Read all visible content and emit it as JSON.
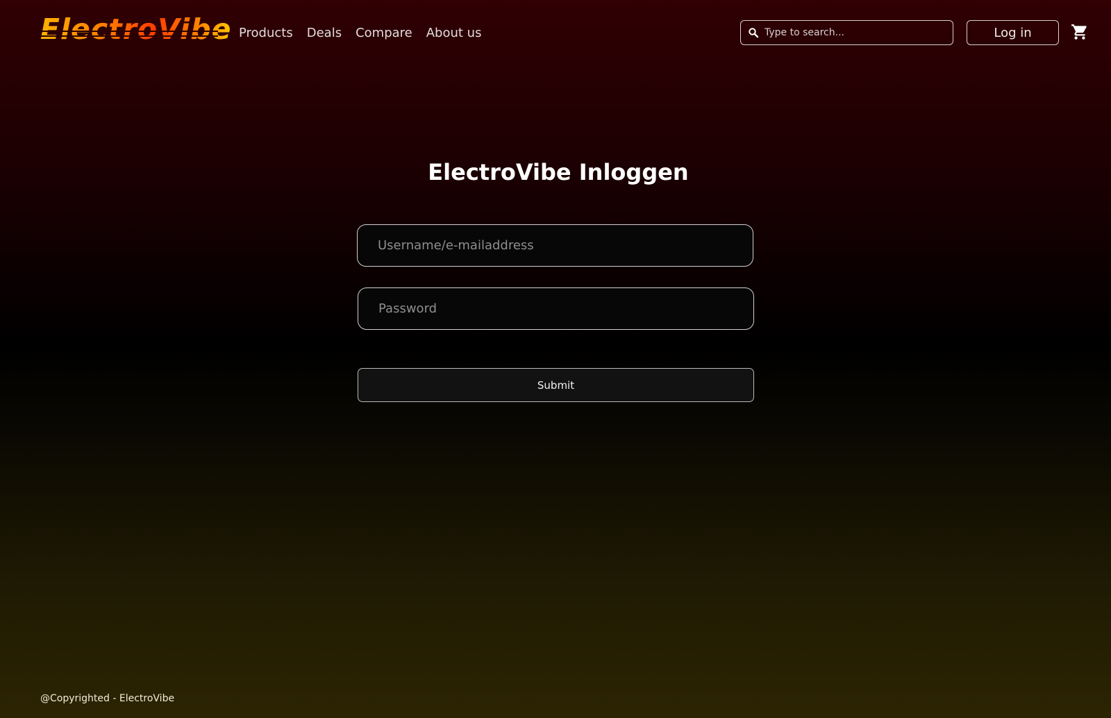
{
  "header": {
    "logo_text": "ElectroVibe",
    "nav": [
      {
        "label": "Products"
      },
      {
        "label": "Deals"
      },
      {
        "label": "Compare"
      },
      {
        "label": "About us"
      }
    ],
    "search": {
      "placeholder": "Type to search...",
      "value": "",
      "icon": "search-icon"
    },
    "login_label": "Log in",
    "cart_icon": "shopping-cart-icon"
  },
  "main": {
    "title": "ElectroVibe Inloggen",
    "username": {
      "placeholder": "Username/e-mailaddress",
      "value": ""
    },
    "password": {
      "placeholder": "Password",
      "value": ""
    },
    "submit_label": "Submit"
  },
  "footer": {
    "copyright": "@Copyrighted - ElectroVibe"
  },
  "colors": {
    "logo_gradient": [
      "#ffb300",
      "#ff3d00",
      "#ffc400"
    ],
    "background_top": "#300003",
    "background_middle": "#000000",
    "background_bottom": "#2c2402"
  }
}
